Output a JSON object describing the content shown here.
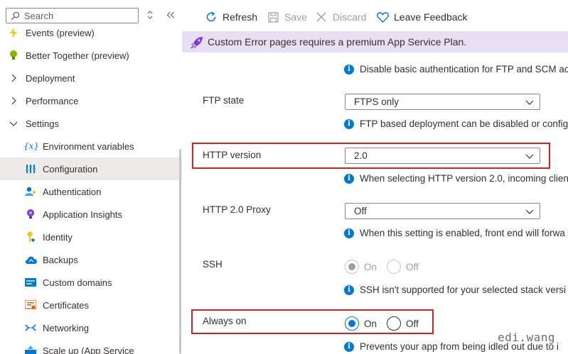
{
  "sidebar": {
    "search_placeholder": "Search",
    "expand_icon": "chevron-updown-icon",
    "collapse_icon": "double-chevron-left-icon",
    "items": [
      {
        "label": "Events (preview)",
        "icon": "lightning-icon",
        "color": "#f2c811"
      },
      {
        "label": "Better Together (preview)",
        "icon": "lightbulb-icon",
        "color": "#7fba00"
      },
      {
        "label": "Deployment",
        "icon": "chevron-right-icon"
      },
      {
        "label": "Performance",
        "icon": "chevron-right-icon"
      },
      {
        "label": "Settings",
        "icon": "chevron-down-icon"
      },
      {
        "label": "Environment variables",
        "icon": "variable-icon",
        "color": "#0078d4"
      },
      {
        "label": "Configuration",
        "icon": "sliders-icon",
        "color": "#0078d4",
        "active": true
      },
      {
        "label": "Authentication",
        "icon": "user-key-icon",
        "color": "#0078d4"
      },
      {
        "label": "Application Insights",
        "icon": "insights-bulb-icon",
        "color": "#773adc"
      },
      {
        "label": "Identity",
        "icon": "identity-key-icon",
        "color": "#f2c811"
      },
      {
        "label": "Backups",
        "icon": "cloud-backup-icon",
        "color": "#0078d4"
      },
      {
        "label": "Custom domains",
        "icon": "domain-card-icon",
        "color": "#0078d4"
      },
      {
        "label": "Certificates",
        "icon": "certificate-icon",
        "color": "#e8590c"
      },
      {
        "label": "Networking",
        "icon": "network-icon",
        "color": "#0078d4"
      },
      {
        "label": "Scale up (App Service",
        "icon": "scale-up-icon",
        "color": "#0078d4"
      }
    ]
  },
  "toolbar": {
    "refresh": "Refresh",
    "save": "Save",
    "discard": "Discard",
    "feedback": "Leave Feedback"
  },
  "banner": {
    "text": "Custom Error pages requires a premium App Service Plan.",
    "icon": "rocket-icon"
  },
  "settings": {
    "basic_auth_info": "Disable basic authentication for FTP and SCM ac",
    "ftp_state": {
      "label": "FTP state",
      "value": "FTPS only",
      "info": "FTP based deployment can be disabled or config"
    },
    "http_version": {
      "label": "HTTP version",
      "value": "2.0",
      "info": "When selecting HTTP version 2.0, incoming clien"
    },
    "http2_proxy": {
      "label": "HTTP 2.0 Proxy",
      "value": "Off",
      "info": "When this setting is enabled, front end will forwa"
    },
    "ssh": {
      "label": "SSH",
      "on": "On",
      "off": "Off",
      "selected": "On",
      "info": "SSH isn't supported for your selected stack versi"
    },
    "always_on": {
      "label": "Always on",
      "on": "On",
      "off": "Off",
      "selected": "On",
      "info": "Prevents your app from being idled out due to i"
    }
  },
  "watermark": "edi.wang"
}
